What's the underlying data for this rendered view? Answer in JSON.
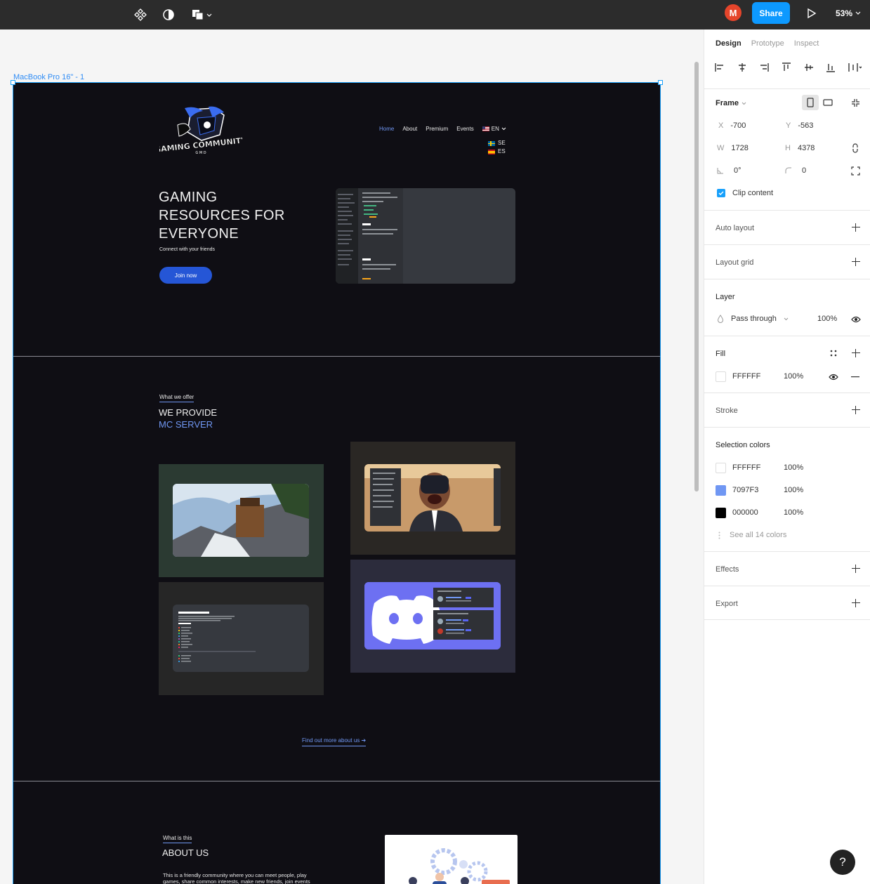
{
  "toolbar": {
    "avatar_initial": "M",
    "share_label": "Share",
    "zoom": "53%"
  },
  "canvas": {
    "frame_label": "MacBook Pro 16\" - 1"
  },
  "site": {
    "nav": [
      "Home",
      "About",
      "Premium",
      "Events"
    ],
    "lang_current": "EN",
    "lang_options": [
      "SE",
      "ES"
    ],
    "hero_title_lines": [
      "GAMING",
      "RESOURCES FOR",
      "EVERYONE"
    ],
    "hero_subtitle": "Connect with your friends",
    "join_button": "Join now",
    "offer_label": "What we offer",
    "offer_title_1": "WE PROVIDE",
    "offer_title_2": "MC SERVER",
    "more_link": "Find out more about us ➔",
    "about_label": "What is this",
    "about_title": "ABOUT US",
    "about_text": "This is a friendly community where you can meet people, play games, share common interests, make new friends, join events"
  },
  "panel": {
    "tabs": [
      "Design",
      "Prototype",
      "Inspect"
    ],
    "frame_title": "Frame",
    "x_label": "X",
    "x_value": "-700",
    "y_label": "Y",
    "y_value": "-563",
    "w_label": "W",
    "w_value": "1728",
    "h_label": "H",
    "h_value": "4378",
    "rotation": "0°",
    "radius": "0",
    "clip_content": "Clip content",
    "auto_layout": "Auto layout",
    "layout_grid": "Layout grid",
    "layer": "Layer",
    "blend_mode": "Pass through",
    "layer_opacity": "100%",
    "fill": "Fill",
    "fill_hex": "FFFFFF",
    "fill_opacity": "100%",
    "stroke": "Stroke",
    "selection_colors": "Selection colors",
    "colors": [
      {
        "hex": "FFFFFF",
        "opacity": "100%",
        "swatch": "#FFFFFF"
      },
      {
        "hex": "7097F3",
        "opacity": "100%",
        "swatch": "#7097F3"
      },
      {
        "hex": "000000",
        "opacity": "100%",
        "swatch": "#000000"
      }
    ],
    "see_all": "See all 14 colors",
    "effects": "Effects",
    "export": "Export"
  },
  "help_label": "?"
}
